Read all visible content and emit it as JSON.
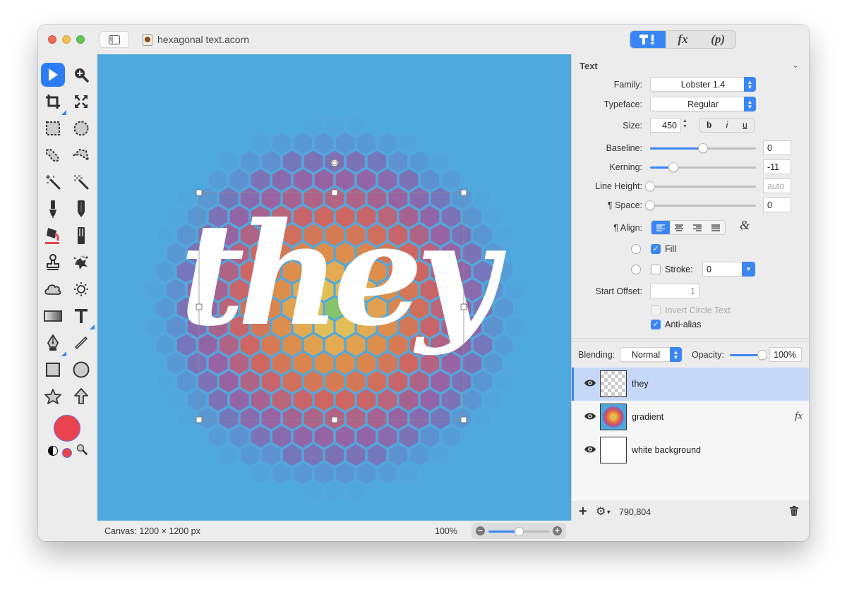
{
  "window": {
    "title": "hexagonal text.acorn",
    "mode_tabs": [
      {
        "id": "tools",
        "label": "T!",
        "active": true
      },
      {
        "id": "effects",
        "label": "fx",
        "active": false
      },
      {
        "id": "params",
        "label": "(p)",
        "active": false
      }
    ]
  },
  "toolbox": {
    "tools": [
      {
        "name": "move-tool",
        "selected": true
      },
      {
        "name": "zoom-tool"
      },
      {
        "name": "crop-tool",
        "has_submenu": true
      },
      {
        "name": "transform-tool"
      },
      {
        "name": "rect-select-tool"
      },
      {
        "name": "ellipse-select-tool"
      },
      {
        "name": "lasso-tool"
      },
      {
        "name": "polygon-lasso-tool"
      },
      {
        "name": "magic-wand-tool"
      },
      {
        "name": "instant-alpha-tool"
      },
      {
        "name": "brush-tool"
      },
      {
        "name": "pencil-tool"
      },
      {
        "name": "paint-bucket-tool"
      },
      {
        "name": "eraser-tool"
      },
      {
        "name": "clone-tool"
      },
      {
        "name": "splatter-tool"
      },
      {
        "name": "smudge-tool"
      },
      {
        "name": "dodge-burn-tool"
      },
      {
        "name": "gradient-tool"
      },
      {
        "name": "text-tool",
        "has_submenu": true
      },
      {
        "name": "bezier-pen-tool",
        "has_submenu": true
      },
      {
        "name": "line-tool"
      },
      {
        "name": "rectangle-tool"
      },
      {
        "name": "oval-tool"
      },
      {
        "name": "star-tool"
      },
      {
        "name": "arrow-tool"
      }
    ],
    "foreground_color": "#e8434f",
    "background_color": "#e8434f"
  },
  "canvas": {
    "text": "they",
    "background_color": "#4da8de"
  },
  "statusbar": {
    "canvas_size": "Canvas: 1200 × 1200 px",
    "zoom_label": "100%",
    "zoom_fraction": 0.5
  },
  "inspector": {
    "section_title": "Text",
    "family_label": "Family:",
    "family_value": "Lobster 1.4",
    "typeface_label": "Typeface:",
    "typeface_value": "Regular",
    "size_label": "Size:",
    "size_value": "450",
    "style_buttons": [
      "b",
      "i",
      "u"
    ],
    "baseline_label": "Baseline:",
    "baseline_value": "0",
    "baseline_fraction": 0.5,
    "kerning_label": "Kerning:",
    "kerning_value": "-11",
    "kerning_fraction": 0.22,
    "line_height_label": "Line Height:",
    "line_height_value": "auto",
    "line_height_fraction": 0,
    "space_label": "¶ Space:",
    "space_value": "0",
    "space_fraction": 0,
    "align_label": "¶ Align:",
    "align_options": [
      "left",
      "center",
      "right",
      "justify"
    ],
    "align_selected": "left",
    "fill_label": "Fill",
    "fill_checked": true,
    "stroke_label": "Stroke:",
    "stroke_checked": false,
    "stroke_value": "0",
    "start_offset_label": "Start Offset:",
    "start_offset_value": "1",
    "invert_circle_label": "Invert Circle Text",
    "invert_circle_checked": false,
    "antialias_label": "Anti-alias",
    "antialias_checked": true
  },
  "layers_panel": {
    "blending_label": "Blending:",
    "blending_value": "Normal",
    "opacity_label": "Opacity:",
    "opacity_value": "100%",
    "opacity_fraction": 1.0,
    "layers": [
      {
        "name": "they",
        "visible": true,
        "selected": true,
        "type": "text",
        "fx": false
      },
      {
        "name": "gradient",
        "visible": true,
        "selected": false,
        "type": "bitmap",
        "fx": true,
        "fx_label": "fx"
      },
      {
        "name": "white background",
        "visible": true,
        "selected": false,
        "type": "bitmap",
        "fx": false
      }
    ],
    "coords": "790,804"
  }
}
